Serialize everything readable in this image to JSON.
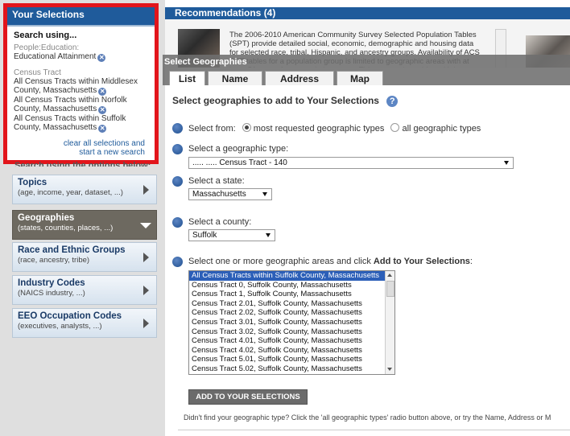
{
  "your_selections": {
    "header": "Your Selections",
    "search_using": "Search using...",
    "groups": [
      {
        "category": "People:Education:",
        "items": [
          "Educational Attainment"
        ]
      },
      {
        "category": "Census Tract",
        "items": [
          "All Census Tracts within Middlesex County, Massachusetts",
          "All Census Tracts within Norfolk County, Massachusetts",
          "All Census Tracts within Suffolk County, Massachusetts"
        ]
      }
    ],
    "clear_link_line1": "clear all selections and",
    "clear_link_line2": "start a new search"
  },
  "search_options_label": "Search using the options below:",
  "nav": [
    {
      "title": "Topics",
      "sub": "(age, income, year, dataset, ...)"
    },
    {
      "title": "Geographies",
      "sub": "(states, counties, places, ...)",
      "active": true
    },
    {
      "title": "Race and Ethnic Groups",
      "sub": "(race, ancestry, tribe)"
    },
    {
      "title": "Industry Codes",
      "sub": "(NAICS industry, ...)"
    },
    {
      "title": "EEO Occupation Codes",
      "sub": "(executives, analysts, ...)"
    }
  ],
  "recommendations": {
    "header": "Recommendations (4)",
    "text": "The 2006-2010 American Community Survey Selected Population Tables (SPT) provide detailed social, economic, demographic and housing data for selected race, tribal, Hispanic, and ancestry groups. Availability of ACS SPT tables for a population group is limited to geographic areas with at least 50 cases for a population group. This means that tables with less than 50 unweighted"
  },
  "select_geographies": {
    "title": "Select Geographies",
    "tabs": [
      "List",
      "Name",
      "Address",
      "Map"
    ],
    "heading": "Select geographies to add to Your Selections",
    "help_icon": "?",
    "select_from_label": "Select from:",
    "radio_most": "most requested geographic types",
    "radio_all": "all geographic types",
    "geo_type_label": "Select a geographic type:",
    "geo_type_value": "..... ..... Census Tract - 140",
    "state_label": "Select a state:",
    "state_value": "Massachusetts",
    "county_label": "Select a county:",
    "county_value": "Suffolk",
    "areas_label_prefix": "Select one or more geographic areas and click ",
    "areas_label_bold": "Add to Your Selections",
    "areas_label_suffix": ":",
    "areas": [
      "All Census Tracts within Suffolk County, Massachusetts",
      "Census Tract 0, Suffolk County, Massachusetts",
      "Census Tract 1, Suffolk County, Massachusetts",
      "Census Tract 2.01, Suffolk County, Massachusetts",
      "Census Tract 2.02, Suffolk County, Massachusetts",
      "Census Tract 3.01, Suffolk County, Massachusetts",
      "Census Tract 3.02, Suffolk County, Massachusetts",
      "Census Tract 4.01, Suffolk County, Massachusetts",
      "Census Tract 4.02, Suffolk County, Massachusetts",
      "Census Tract 5.01, Suffolk County, Massachusetts",
      "Census Tract 5.02, Suffolk County, Massachusetts"
    ],
    "add_button": "ADD TO YOUR SELECTIONS",
    "footer_note": "Didn't find your geographic type? Click the 'all geographic types' radio button above, or try the Name, Address or M"
  },
  "colors": {
    "header_blue": "#1f5b9b",
    "highlight": "#e2151b",
    "list_selected": "#2c5fb8"
  }
}
